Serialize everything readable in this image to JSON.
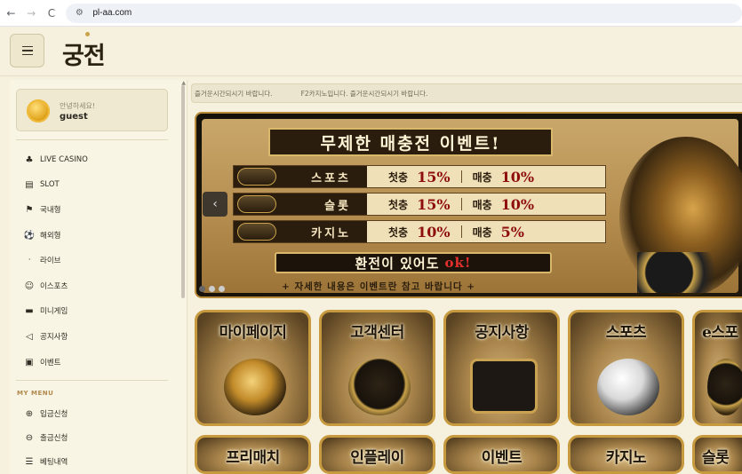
{
  "browser": {
    "url": "pl-aa.com",
    "back_icon": "←",
    "forward_icon": "→",
    "reload_icon": "C",
    "site_icon": "⚙"
  },
  "header": {
    "logo_text": "궁전"
  },
  "sidebar": {
    "greeting": "안녕하세요!",
    "username": "guest",
    "items": [
      {
        "label": "LIVE CASINO",
        "icon": "♣"
      },
      {
        "label": "SLOT",
        "icon": "▤"
      },
      {
        "label": "국내형",
        "icon": "⚑"
      },
      {
        "label": "해외형",
        "icon": "⚽"
      },
      {
        "label": "라이브",
        "icon": "ᐧ"
      },
      {
        "label": "이스포츠",
        "icon": "☺"
      },
      {
        "label": "미니게임",
        "icon": "▬"
      },
      {
        "label": "공지사항",
        "icon": "◁"
      },
      {
        "label": "이벤트",
        "icon": "▣"
      }
    ],
    "section_title": "MY MENU",
    "my_menu": [
      {
        "label": "입금신청",
        "icon": "⊕"
      },
      {
        "label": "출금신청",
        "icon": "⊖"
      },
      {
        "label": "베팅내역",
        "icon": "☰"
      }
    ]
  },
  "ticker": {
    "message_1": "즐거운시간되시기 바랍니다.",
    "message_2": "F2카지노입니다. 즐거운시간되시기 바랍니다."
  },
  "banner": {
    "title": "무제한 매충전 이벤트!",
    "rows": [
      {
        "name": "스포츠",
        "first": "첫충",
        "first_pct": "15%",
        "every": "매충",
        "every_pct": "10%"
      },
      {
        "name": "슬롯",
        "first": "첫충",
        "first_pct": "15%",
        "every": "매충",
        "every_pct": "10%"
      },
      {
        "name": "카지노",
        "first": "첫충",
        "first_pct": "10%",
        "every": "매충",
        "every_pct": "5%"
      }
    ],
    "ok_text": "환전이 있어도",
    "ok_emph": "ok!",
    "note": "+  자세한 내용은 이벤트란 참고 바랍니다  +",
    "prev_icon": "‹"
  },
  "tiles_row1": [
    "마이페이지",
    "고객센터",
    "공지사항",
    "스포츠",
    "e스포"
  ],
  "tiles_row2": [
    "프리매치",
    "인플레이",
    "이벤트",
    "카지노",
    "슬롯"
  ],
  "colors": {
    "accent_gold": "#c89a3f",
    "page_bg": "#f6f1de",
    "highlight_red": "#8e0d0d"
  }
}
